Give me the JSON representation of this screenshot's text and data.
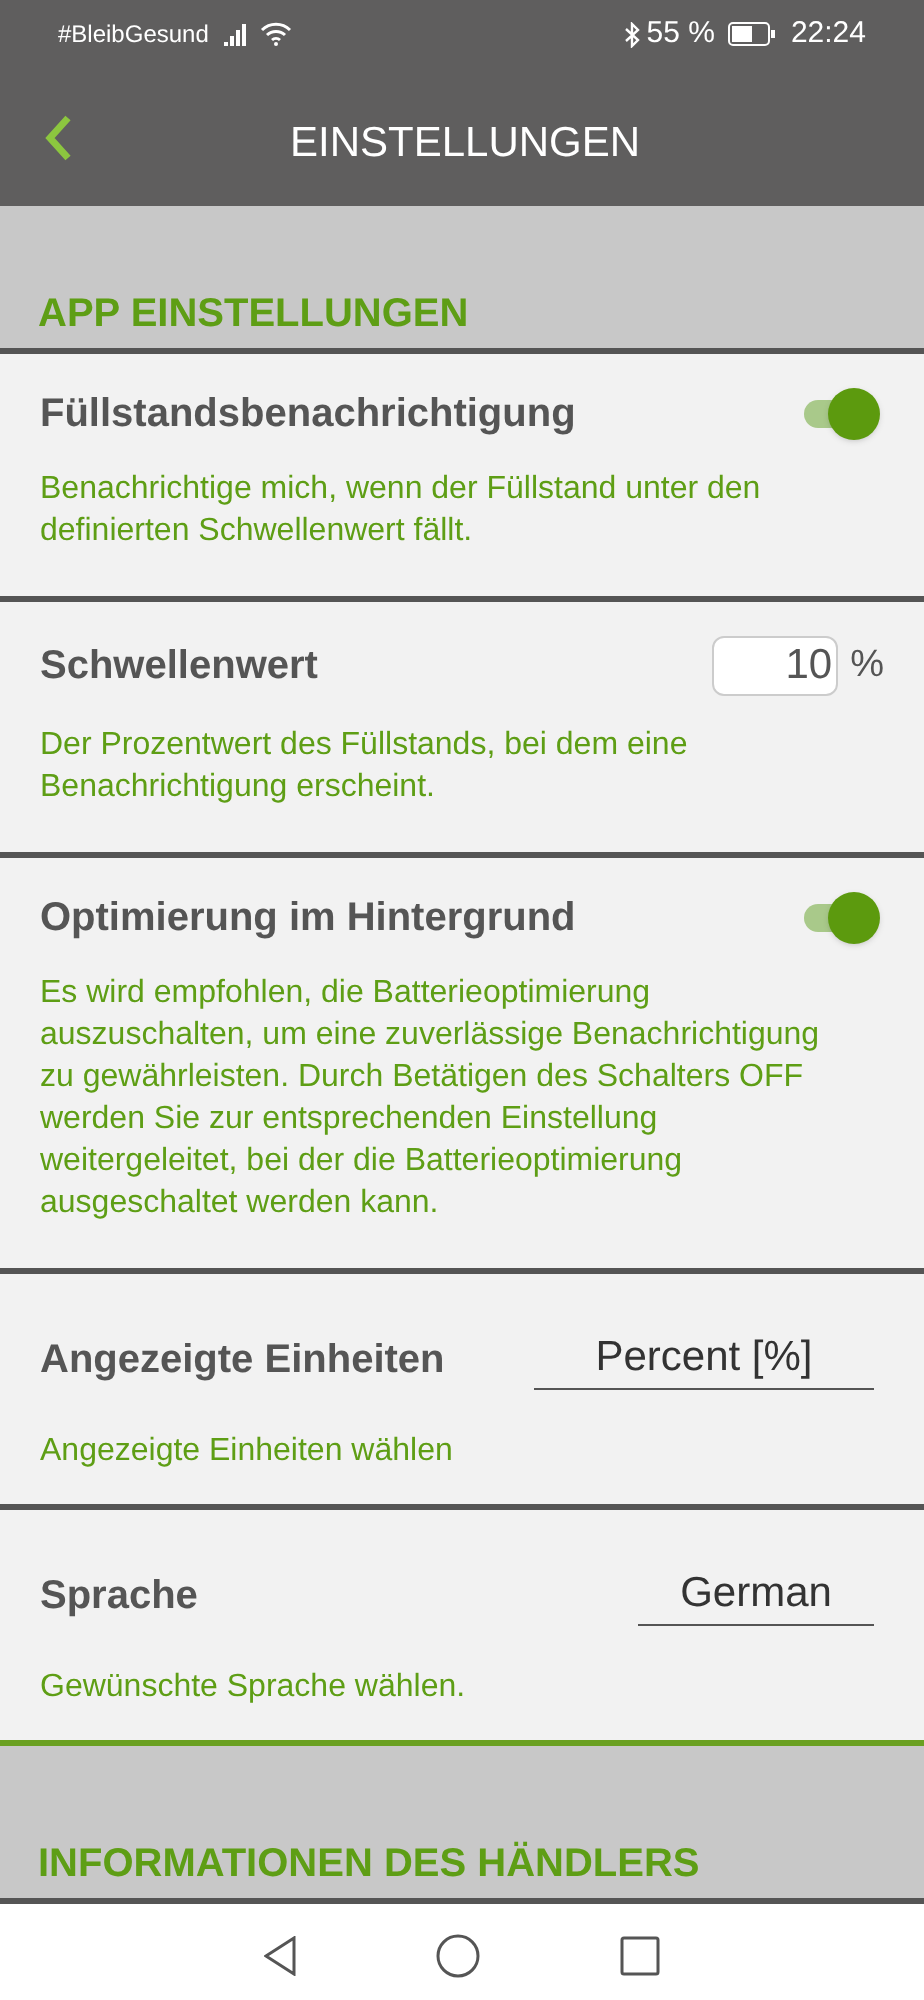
{
  "status_bar": {
    "carrier": "#BleibGesund",
    "battery_text": "55 %",
    "time": "22:24"
  },
  "header": {
    "title": "EINSTELLUNGEN"
  },
  "sections": [
    {
      "title": "APP EINSTELLUNGEN",
      "items": [
        {
          "kind": "toggle",
          "title": "Füllstandsbenachrichtigung",
          "on": true,
          "description": "Benachrichtige mich, wenn der Füllstand unter den definierten Schwellenwert fällt."
        },
        {
          "kind": "number",
          "title": "Schwellenwert",
          "value": "10",
          "unit": "%",
          "description": "Der Prozentwert des Füllstands, bei dem eine Benachrichtigung erscheint."
        },
        {
          "kind": "toggle",
          "title": "Optimierung im Hintergrund",
          "on": true,
          "description": "Es wird empfohlen, die Batterieoptimierung auszuschalten, um eine zuverlässige Benachrichtigung zu gewährleisten. Durch Betätigen des Schalters OFF werden Sie zur entsprechenden Einstellung weitergeleitet, bei der die Batterieoptimierung ausgeschaltet werden kann."
        },
        {
          "kind": "select",
          "title": "Angezeigte Einheiten",
          "value": "Percent [%]",
          "description": "Angezeigte Einheiten wählen"
        },
        {
          "kind": "select",
          "title": "Sprache",
          "value": "German",
          "description": "Gewünschte Sprache wählen."
        }
      ]
    },
    {
      "title": "INFORMATIONEN DES HÄNDLERS"
    }
  ]
}
